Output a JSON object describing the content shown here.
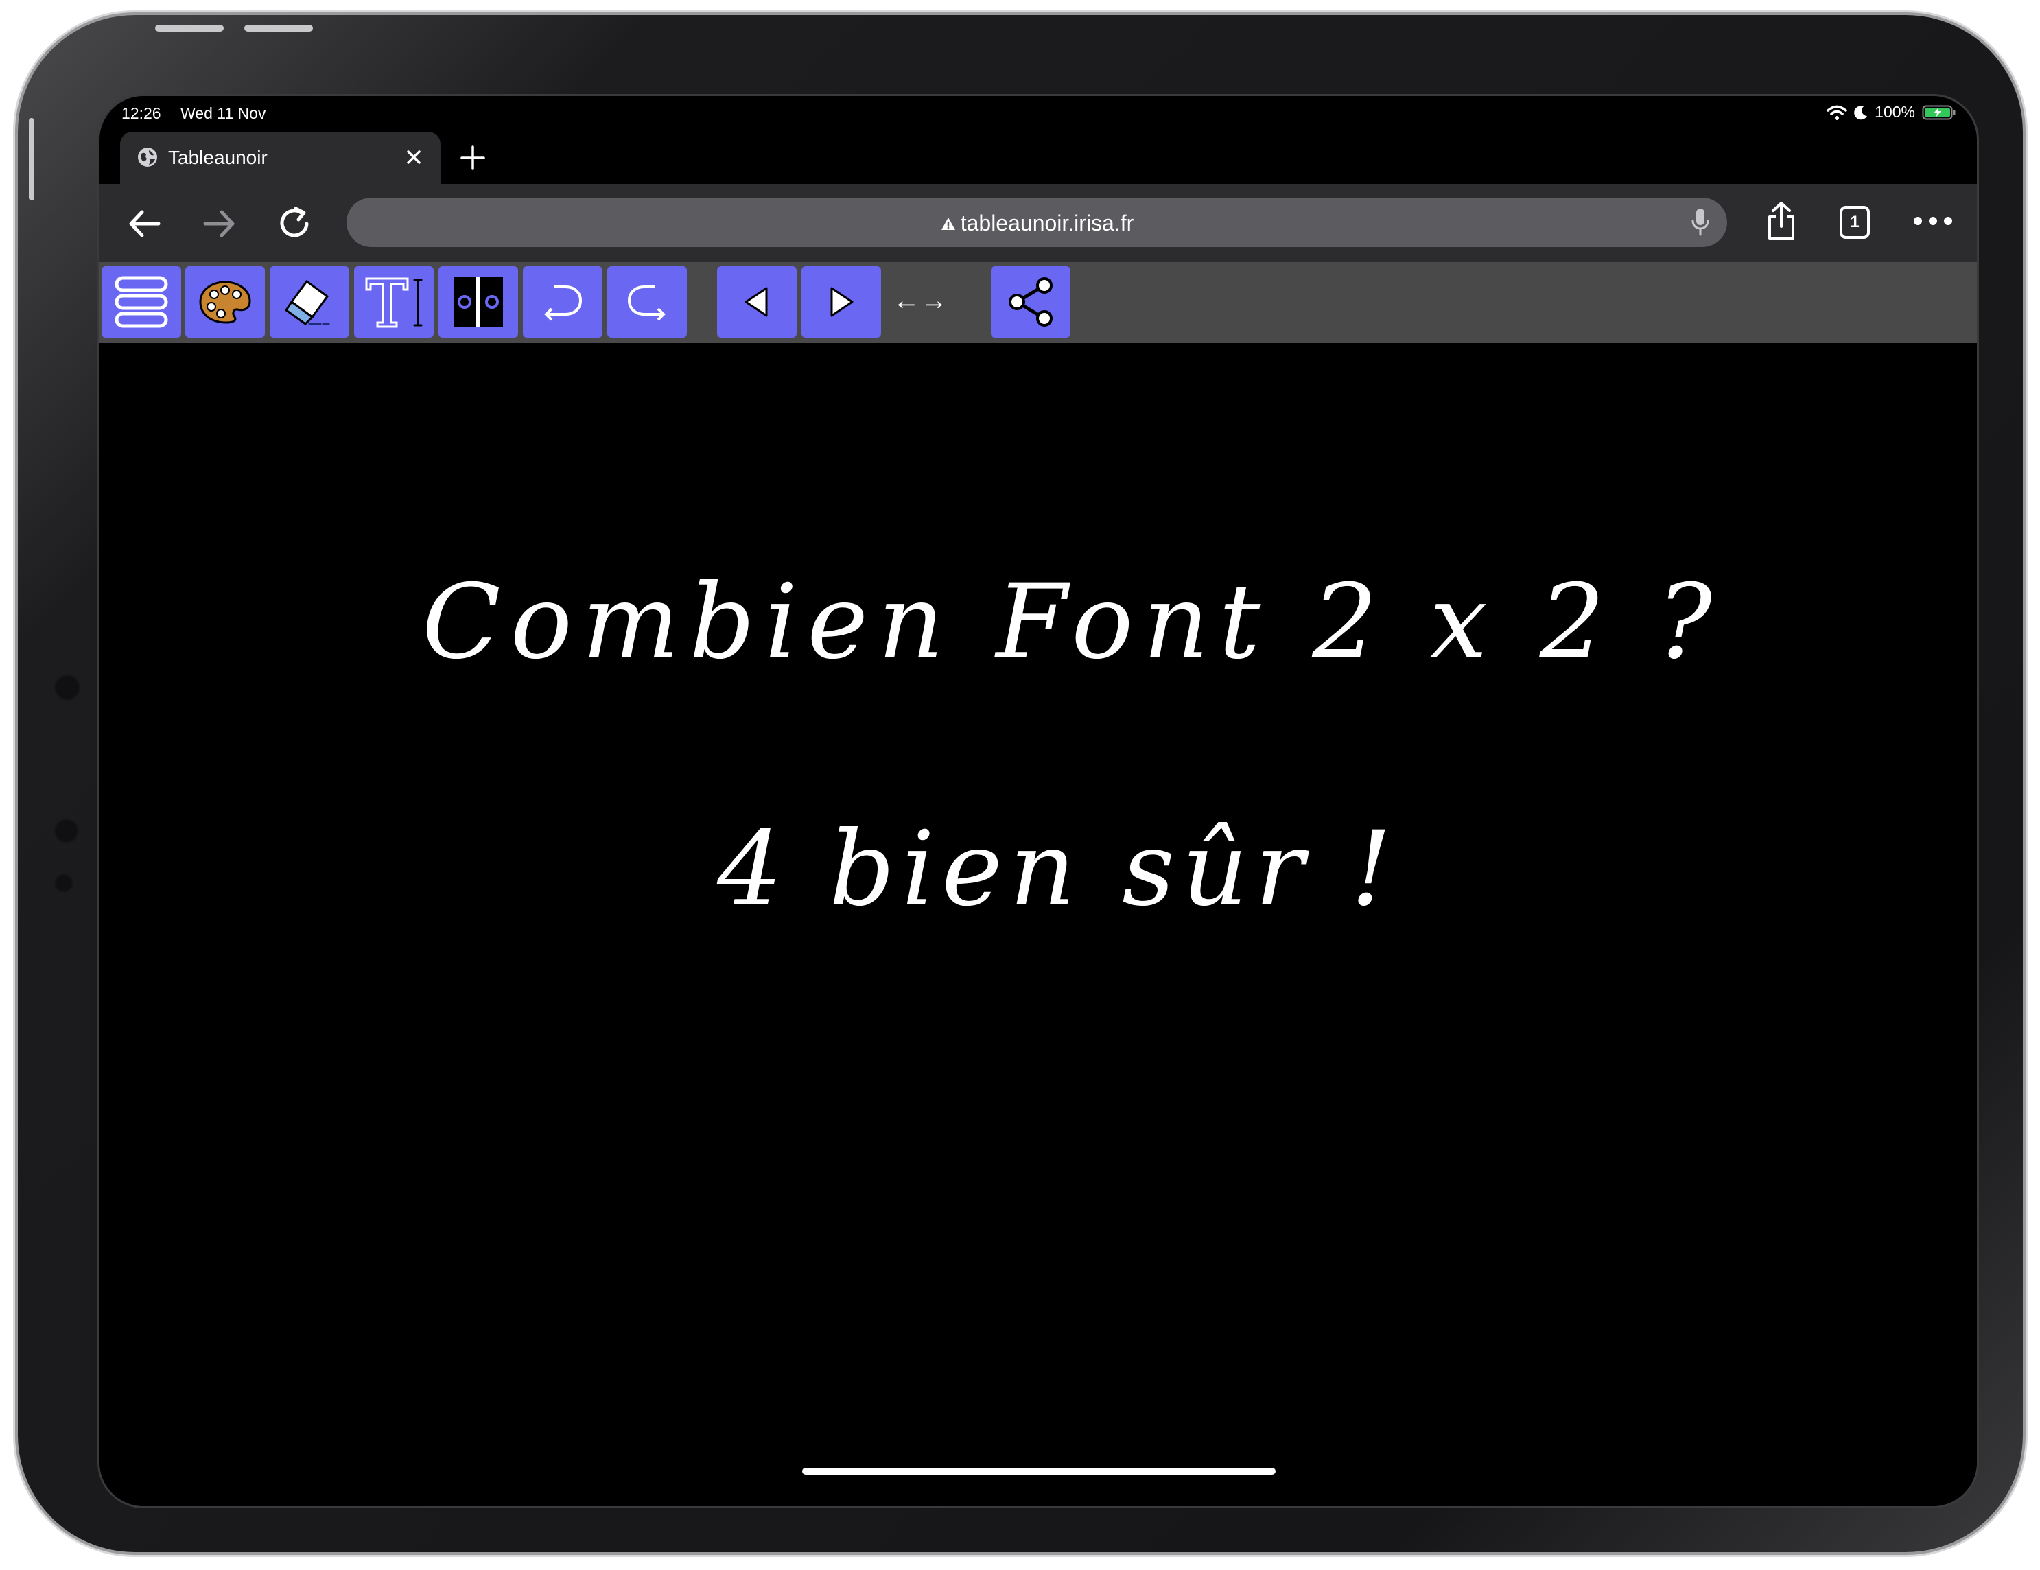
{
  "status": {
    "time": "12:26",
    "date": "Wed 11 Nov",
    "battery": "100%",
    "battery_color": "#34c759"
  },
  "browser": {
    "tab_title": "Tableaunoir",
    "url": "tableaunoir.irisa.fr",
    "tab_count": "1",
    "accent": "#6a67f2"
  },
  "toolbar": {
    "arrows_label": "←→",
    "tools": [
      {
        "name": "menu-icon"
      },
      {
        "name": "palette-icon"
      },
      {
        "name": "eraser-icon"
      },
      {
        "name": "text-tool-icon"
      },
      {
        "name": "split-view-icon"
      },
      {
        "name": "undo-icon"
      },
      {
        "name": "redo-icon"
      },
      {
        "name": "previous-icon"
      },
      {
        "name": "next-icon"
      },
      {
        "name": "share-icon"
      }
    ]
  },
  "board": {
    "line1": "Combien Font 2 x 2 ?",
    "line2": "4 bien sûr !"
  }
}
